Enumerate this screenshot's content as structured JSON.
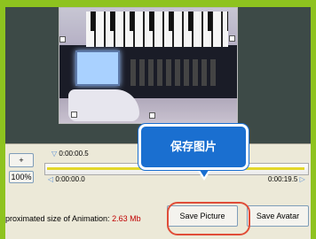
{
  "timeline": {
    "plus_label": "+",
    "zoom_label": "100%",
    "start_marker": "0:00:00.5",
    "current_time": "0:00:00.0",
    "end_time": "0:00:19.5"
  },
  "info": {
    "approx_label": "proximated size of Animation:",
    "approx_value": "2.63 Mb"
  },
  "actions": {
    "save_picture": "Save Picture",
    "save_avatar": "Save Avatar"
  },
  "callout": {
    "text": "保存图片"
  },
  "colors": {
    "frame": "#8ec31f",
    "callout_bg": "#1a6fd0",
    "highlight": "#e04d38",
    "size_value": "#c00000"
  }
}
